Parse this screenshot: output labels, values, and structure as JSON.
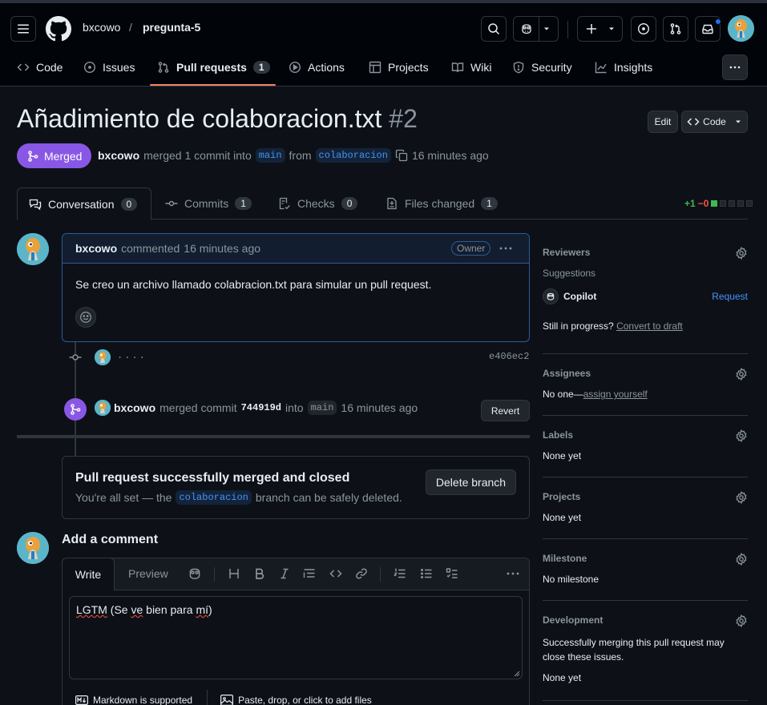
{
  "header": {
    "owner": "bxcowo",
    "separator": "/",
    "repo": "pregunta-5"
  },
  "nav_tabs": [
    {
      "label": "Code",
      "icon": "code-icon"
    },
    {
      "label": "Issues",
      "icon": "issue-opened-icon"
    },
    {
      "label": "Pull requests",
      "icon": "git-pull-request-icon",
      "count": "1"
    },
    {
      "label": "Actions",
      "icon": "play-icon"
    },
    {
      "label": "Projects",
      "icon": "table-icon"
    },
    {
      "label": "Wiki",
      "icon": "book-icon"
    },
    {
      "label": "Security",
      "icon": "shield-icon"
    },
    {
      "label": "Insights",
      "icon": "graph-icon"
    }
  ],
  "pr": {
    "title": "Añadimiento de colaboracion.txt",
    "number": "#2",
    "edit_label": "Edit",
    "code_label": "Code",
    "state": "Merged",
    "author": "bxcowo",
    "meta_merged": "merged 1 commit into",
    "base_branch": "main",
    "meta_from": "from",
    "head_branch": "colaboracion",
    "time": "16 minutes ago"
  },
  "pr_tabs": [
    {
      "label": "Conversation",
      "count": "0",
      "icon": "comment-discussion-icon"
    },
    {
      "label": "Commits",
      "count": "1",
      "icon": "git-commit-icon"
    },
    {
      "label": "Checks",
      "count": "0",
      "icon": "checklist-icon"
    },
    {
      "label": "Files changed",
      "count": "1",
      "icon": "file-diff-icon"
    }
  ],
  "diffstat": {
    "added": "+1",
    "removed": "−0"
  },
  "comment": {
    "author": "bxcowo",
    "action": "commented",
    "time": "16 minutes ago",
    "badge": "Owner",
    "body": "Se creo un archivo llamado colabracion.txt para simular un pull request."
  },
  "commit_event": {
    "message": "....",
    "sha": "e406ec2"
  },
  "merge_event": {
    "author": "bxcowo",
    "text_merged": "merged commit",
    "sha": "744919d",
    "text_into": "into",
    "branch": "main",
    "time": "16 minutes ago",
    "revert_label": "Revert"
  },
  "merged_box": {
    "heading": "Pull request successfully merged and closed",
    "text_before": "You're all set — the",
    "branch": "colaboracion",
    "text_after": "branch can be safely deleted.",
    "delete_label": "Delete branch"
  },
  "add_comment": {
    "title": "Add a comment",
    "tab_write": "Write",
    "tab_preview": "Preview",
    "text_words": [
      "LGTM",
      " (Se ",
      "ve",
      " bien para ",
      "mí",
      ")"
    ],
    "markdown_note": "Markdown is supported",
    "attach_note": "Paste, drop, or click to add files"
  },
  "sidebar": {
    "reviewers": {
      "title": "Reviewers",
      "suggestions": "Suggestions",
      "suggested": "Copilot",
      "request": "Request",
      "progress": "Still in progress?",
      "convert": "Convert to draft"
    },
    "assignees": {
      "title": "Assignees",
      "none": "No one—",
      "assign": "assign yourself"
    },
    "labels": {
      "title": "Labels",
      "value": "None yet"
    },
    "projects": {
      "title": "Projects",
      "value": "None yet"
    },
    "milestone": {
      "title": "Milestone",
      "value": "No milestone"
    },
    "development": {
      "title": "Development",
      "desc": "Successfully merging this pull request may close these issues.",
      "value": "None yet"
    }
  },
  "colors": {
    "bg": "#0d1117",
    "header_bg": "#010409",
    "merged_purple": "#8957e5",
    "accent_blue": "#4493f8",
    "tab_underline": "#f78166",
    "add_green": "#3fb950",
    "del_red": "#f85149"
  }
}
